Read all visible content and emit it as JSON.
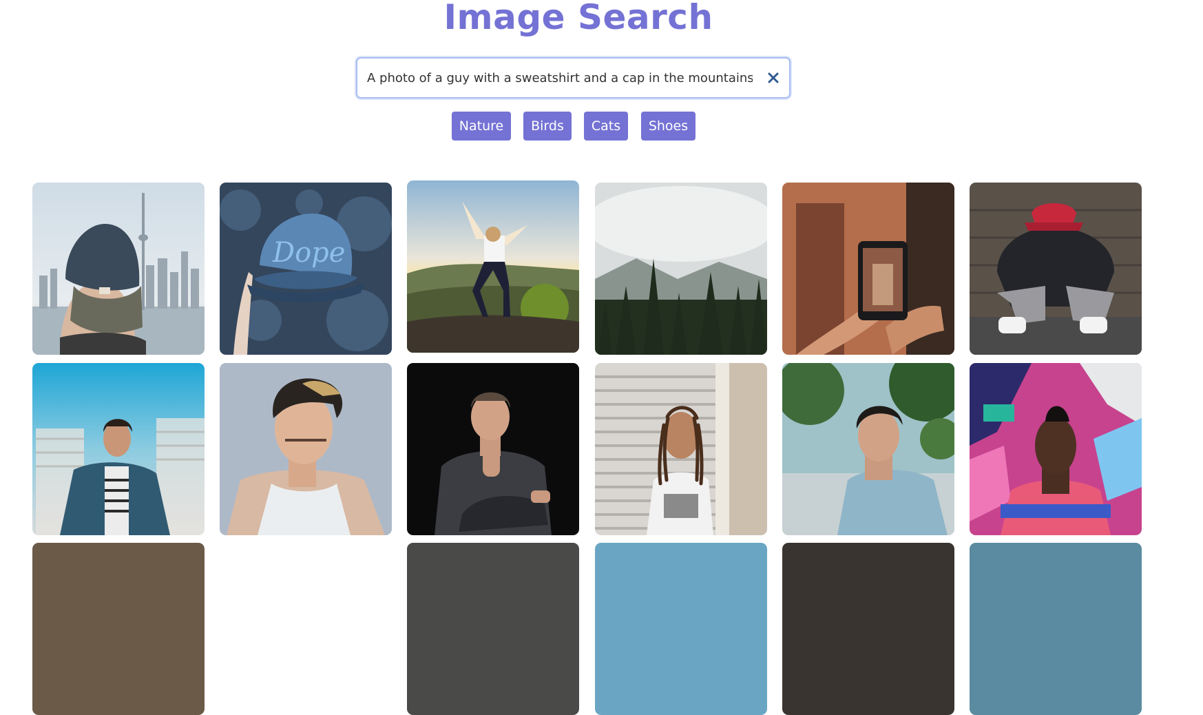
{
  "page": {
    "title": "Image Search"
  },
  "search": {
    "value": "A photo of a guy with a sweatshirt and a cap in the mountains",
    "clear_icon": "close-icon"
  },
  "tags": [
    "Nature",
    "Birds",
    "Cats",
    "Shoes"
  ],
  "colors": {
    "accent": "#7472d4",
    "focus_border": "#a9bdf3",
    "clear_icon": "#2f5a8f"
  },
  "results": [
    {
      "subject": "man in cap facing city skyline with tower"
    },
    {
      "subject": "hand holding blue cap with Dope embroidery"
    },
    {
      "subject": "person with raised arms on mountain at sunset"
    },
    {
      "subject": "misty pine forest"
    },
    {
      "subject": "hands holding smartphone taking photo"
    },
    {
      "subject": "man in red cap sitting against wooden wall"
    },
    {
      "subject": "man in denim shirt in front of blurred buildings"
    },
    {
      "subject": "man in white tank top portrait"
    },
    {
      "subject": "man in dark shirt seated on black background"
    },
    {
      "subject": "man with dreadlocks by metal shutter"
    },
    {
      "subject": "young man in blue t-shirt outdoors"
    },
    {
      "subject": "man in striped shirt in front of graffiti wall"
    }
  ]
}
